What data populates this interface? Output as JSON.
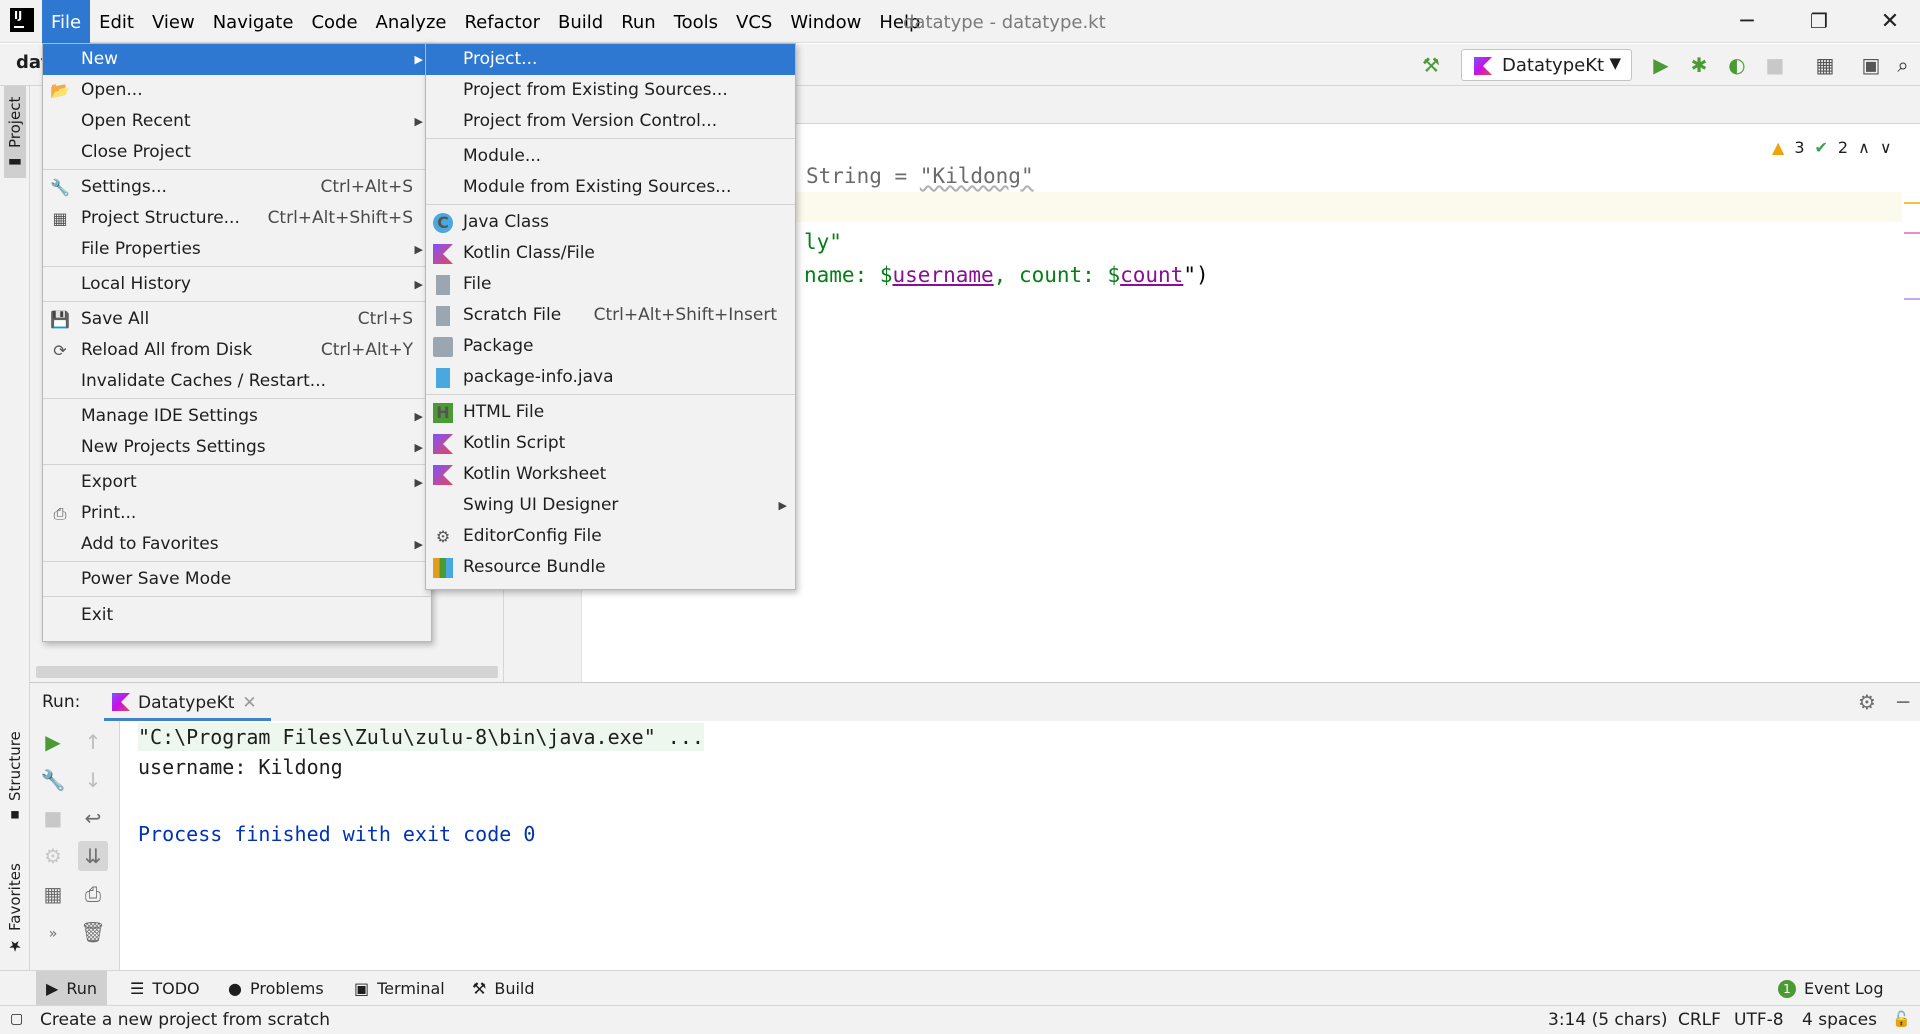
{
  "window": {
    "title": "datatype - datatype.kt",
    "menus": [
      "File",
      "Edit",
      "View",
      "Navigate",
      "Code",
      "Analyze",
      "Refactor",
      "Build",
      "Run",
      "Tools",
      "VCS",
      "Window",
      "Help"
    ],
    "controls": {
      "minimize": "─",
      "restore": "❐",
      "close": "✕"
    }
  },
  "navbar": {
    "breadcrumb": "dat",
    "run_config": "DatatypeKt"
  },
  "sidebar": {
    "project_tab": "Project",
    "structure_tab": "Structure",
    "favorites_tab": "Favorites"
  },
  "editor": {
    "line1_type": "String = ",
    "line1_value": "\"Kildong\"",
    "line2": "ly\"",
    "line3_a": "name: $",
    "line3_var1": "username",
    "line3_b": ", count: $",
    "line3_var2": "count",
    "line3_c": "\")",
    "warnings": "3",
    "checks": "2"
  },
  "file_menu": {
    "items": [
      {
        "label": "New",
        "shortcut": "",
        "submenu": true,
        "icon": ""
      },
      {
        "label": "Open...",
        "shortcut": "",
        "submenu": false,
        "icon": "folder-icon"
      },
      {
        "label": "Open Recent",
        "shortcut": "",
        "submenu": true,
        "icon": ""
      },
      {
        "label": "Close Project",
        "shortcut": "",
        "submenu": false,
        "icon": ""
      },
      {
        "label": "Settings...",
        "shortcut": "Ctrl+Alt+S",
        "submenu": false,
        "icon": "wrench-icon"
      },
      {
        "label": "Project Structure...",
        "shortcut": "Ctrl+Alt+Shift+S",
        "submenu": false,
        "icon": "project-structure-icon"
      },
      {
        "label": "File Properties",
        "shortcut": "",
        "submenu": true,
        "icon": ""
      },
      {
        "label": "Local History",
        "shortcut": "",
        "submenu": true,
        "icon": ""
      },
      {
        "label": "Save All",
        "shortcut": "Ctrl+S",
        "submenu": false,
        "icon": "save-icon"
      },
      {
        "label": "Reload All from Disk",
        "shortcut": "Ctrl+Alt+Y",
        "submenu": false,
        "icon": "reload-icon"
      },
      {
        "label": "Invalidate Caches / Restart...",
        "shortcut": "",
        "submenu": false,
        "icon": ""
      },
      {
        "label": "Manage IDE Settings",
        "shortcut": "",
        "submenu": true,
        "icon": ""
      },
      {
        "label": "New Projects Settings",
        "shortcut": "",
        "submenu": true,
        "icon": ""
      },
      {
        "label": "Export",
        "shortcut": "",
        "submenu": true,
        "icon": ""
      },
      {
        "label": "Print...",
        "shortcut": "",
        "submenu": false,
        "icon": "print-icon"
      },
      {
        "label": "Add to Favorites",
        "shortcut": "",
        "submenu": true,
        "icon": ""
      },
      {
        "label": "Power Save Mode",
        "shortcut": "",
        "submenu": false,
        "icon": ""
      },
      {
        "label": "Exit",
        "shortcut": "",
        "submenu": false,
        "icon": ""
      }
    ]
  },
  "new_menu": {
    "items": [
      {
        "label": "Project...",
        "shortcut": "",
        "icon": ""
      },
      {
        "label": "Project from Existing Sources...",
        "shortcut": "",
        "icon": ""
      },
      {
        "label": "Project from Version Control...",
        "shortcut": "",
        "icon": ""
      },
      {
        "label": "Module...",
        "shortcut": "",
        "icon": ""
      },
      {
        "label": "Module from Existing Sources...",
        "shortcut": "",
        "icon": ""
      },
      {
        "label": "Java Class",
        "shortcut": "",
        "icon": "java-class-icon"
      },
      {
        "label": "Kotlin Class/File",
        "shortcut": "",
        "icon": "kotlin-file-icon"
      },
      {
        "label": "File",
        "shortcut": "",
        "icon": "file-icon"
      },
      {
        "label": "Scratch File",
        "shortcut": "Ctrl+Alt+Shift+Insert",
        "icon": "scratch-file-icon"
      },
      {
        "label": "Package",
        "shortcut": "",
        "icon": "package-icon"
      },
      {
        "label": "package-info.java",
        "shortcut": "",
        "icon": "package-info-icon"
      },
      {
        "label": "HTML File",
        "shortcut": "",
        "icon": "html-file-icon"
      },
      {
        "label": "Kotlin Script",
        "shortcut": "",
        "icon": "kotlin-script-icon"
      },
      {
        "label": "Kotlin Worksheet",
        "shortcut": "",
        "icon": "kotlin-worksheet-icon"
      },
      {
        "label": "Swing UI Designer",
        "shortcut": "",
        "icon": ""
      },
      {
        "label": "EditorConfig File",
        "shortcut": "",
        "icon": "editorconfig-icon"
      },
      {
        "label": "Resource Bundle",
        "shortcut": "",
        "icon": "resource-bundle-icon"
      }
    ]
  },
  "run_panel": {
    "label": "Run:",
    "tab": "DatatypeKt",
    "console": {
      "cmd": "\"C:\\Program Files\\Zulu\\zulu-8\\bin\\java.exe\" ...",
      "output": "username: Kildong",
      "exit": "Process finished with exit code 0"
    }
  },
  "bottom_tools": [
    "Run",
    "TODO",
    "Problems",
    "Terminal",
    "Build"
  ],
  "event_log": {
    "count": "1",
    "label": "Event Log"
  },
  "status": {
    "message": "Create a new project from scratch",
    "position": "3:14 (5 chars)",
    "line_sep": "CRLF",
    "encoding": "UTF-8",
    "indent": "4 spaces"
  }
}
